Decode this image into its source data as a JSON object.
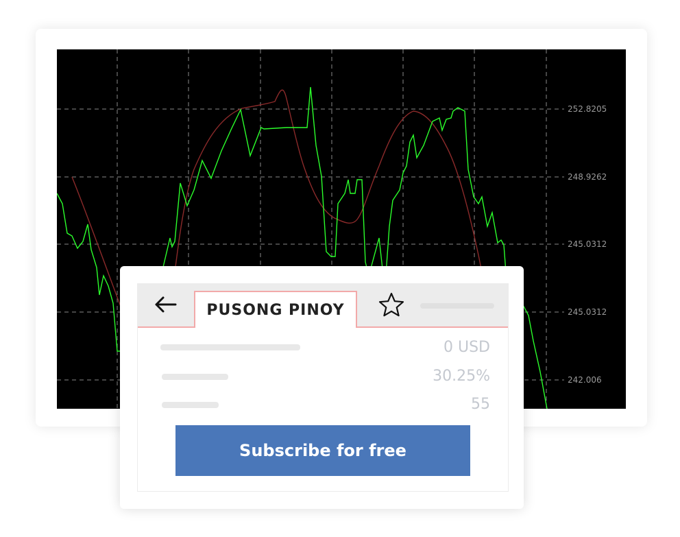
{
  "chart": {
    "y_axis_labels": [
      "252.8205",
      "248.9262",
      "245.0312",
      "245.0312",
      "242.006"
    ],
    "colors": {
      "background": "#000000",
      "grid": "#8a8a8a",
      "price_line": "#2bff2b",
      "moving_average": "#8b2a2a"
    }
  },
  "widget": {
    "back_icon": "arrow-left-icon",
    "tab_title": "PUSONG PINOY",
    "star_icon": "star-outline-icon",
    "rows": [
      {
        "value": "0 USD"
      },
      {
        "value": "30.25%"
      },
      {
        "value": "55"
      }
    ],
    "subscribe_label": "Subscribe for free",
    "colors": {
      "tab_border": "#f2a9a9",
      "button": "#4a77b9",
      "value_text": "#c4c8cf"
    }
  }
}
